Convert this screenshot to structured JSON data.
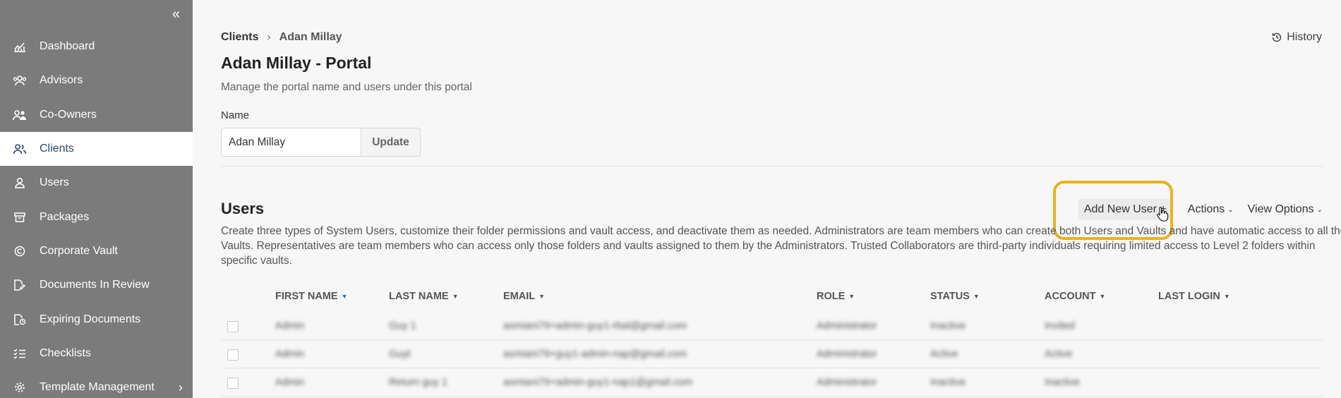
{
  "sidebar": {
    "collapse_icon": "double-chevron-left-icon",
    "items": [
      {
        "label": "Dashboard",
        "icon": "chart-icon"
      },
      {
        "label": "Advisors",
        "icon": "users-group-icon"
      },
      {
        "label": "Co-Owners",
        "icon": "co-owners-icon"
      },
      {
        "label": "Clients",
        "icon": "clients-icon",
        "active": true
      },
      {
        "label": "Users",
        "icon": "user-icon"
      },
      {
        "label": "Packages",
        "icon": "archive-icon"
      },
      {
        "label": "Corporate Vault",
        "icon": "copyright-icon"
      },
      {
        "label": "Documents In Review",
        "icon": "document-edit-icon"
      },
      {
        "label": "Expiring Documents",
        "icon": "document-clock-icon"
      },
      {
        "label": "Checklists",
        "icon": "checklist-icon"
      },
      {
        "label": "Template Management",
        "icon": "gear-icon",
        "has_submenu": true
      }
    ]
  },
  "breadcrumb": {
    "root": "Clients",
    "separator": "›",
    "current": "Adan Millay"
  },
  "history_label": "History",
  "page": {
    "title": "Adan Millay - Portal",
    "subtitle": "Manage the portal name and users under this portal",
    "name_label": "Name",
    "name_value": "Adan Millay",
    "update_label": "Update"
  },
  "users": {
    "title": "Users",
    "add_label": "Add New User +",
    "actions_label": "Actions",
    "view_options_label": "View Options",
    "description": "Create three types of System Users, customize their folder permissions and vault access, and deactivate them as needed. Administrators are team members who can create both Users and Vaults and have automatic access to all the Vaults. Representatives are team members who can access only those folders and vaults assigned to them by the Administrators. Trusted Collaborators are third-party individuals requiring limited access to Level 2 folders within specific vaults.",
    "columns": [
      "FIRST NAME",
      "LAST NAME",
      "EMAIL",
      "ROLE",
      "STATUS",
      "ACCOUNT",
      "LAST LOGIN"
    ],
    "sorted_column": "FIRST NAME",
    "rows": [
      [
        "Admin",
        "Guy 1",
        "asmiani79+admin-guy1-rbal@gmail.com",
        "Administrator",
        "Inactive",
        "Invited",
        ""
      ],
      [
        "Admin",
        "Guyt",
        "asmiani79+guy1-admin-nap@gmail.com",
        "Administrator",
        "Active",
        "Active",
        ""
      ],
      [
        "Admin",
        "Return guy 1",
        "asmiani79+admin-guy1-nap1@gmail.com",
        "Administrator",
        "Inactive",
        "Inactive",
        ""
      ]
    ]
  },
  "colors": {
    "sidebar_bg": "#7b7b7b",
    "active_text": "#2b4a6b",
    "highlight": "#e8b321",
    "sort_accent": "#2a6fb0"
  }
}
